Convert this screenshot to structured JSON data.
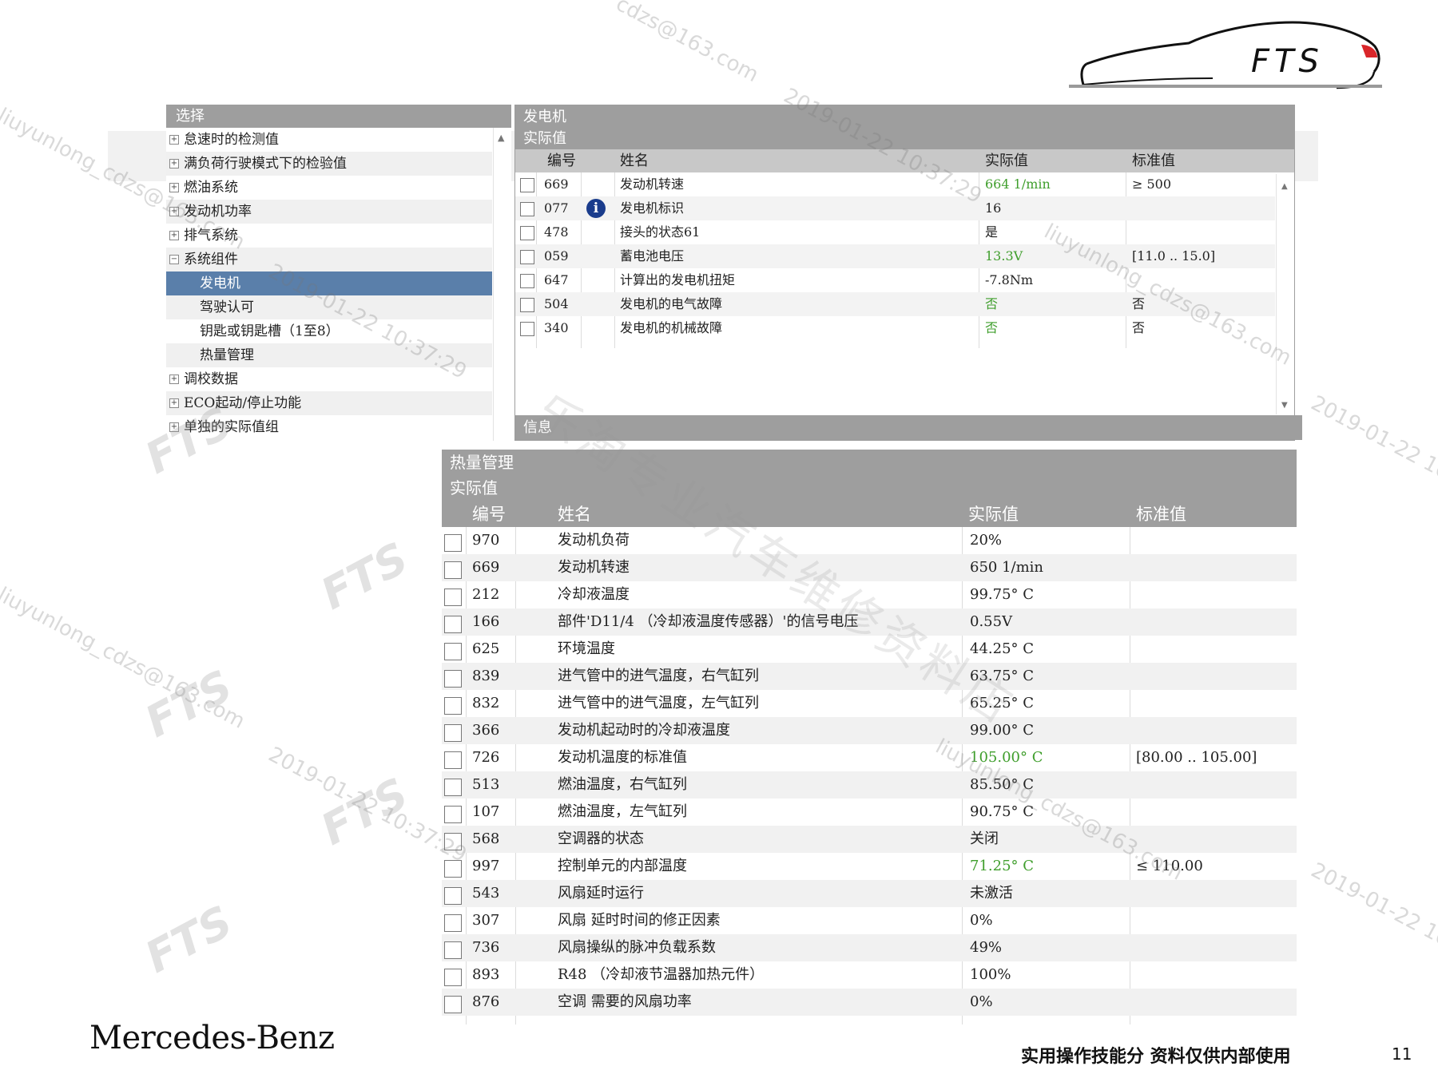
{
  "logo": {
    "text": "FTS"
  },
  "tree": {
    "title": "选择",
    "items": [
      {
        "label": "怠速时的检测值",
        "expander": "+"
      },
      {
        "label": "满负荷行驶模式下的检验值",
        "expander": "+"
      },
      {
        "label": "燃油系统",
        "expander": "+"
      },
      {
        "label": "发动机功率",
        "expander": "+"
      },
      {
        "label": "排气系统",
        "expander": "+"
      },
      {
        "label": "系统组件",
        "expander": "−"
      },
      {
        "label": "发电机",
        "expander": ""
      },
      {
        "label": "驾驶认可",
        "expander": ""
      },
      {
        "label": "钥匙或钥匙槽（1至8）",
        "expander": ""
      },
      {
        "label": "热量管理",
        "expander": ""
      },
      {
        "label": "调校数据",
        "expander": "+"
      },
      {
        "label": "ECO起动/停止功能",
        "expander": "+"
      },
      {
        "label": "单独的实际值组",
        "expander": "+"
      }
    ]
  },
  "generator": {
    "title": "发电机",
    "subtitle": "实际值",
    "columns": {
      "id": "编号",
      "name": "姓名",
      "actual": "实际值",
      "standard": "标准值"
    },
    "rows": [
      {
        "id": "669",
        "name": "发动机转速",
        "actual": "664 1/min",
        "standard": "≥ 500",
        "green": true
      },
      {
        "id": "077",
        "name": "发电机标识",
        "actual": "16",
        "standard": "",
        "info": "i"
      },
      {
        "id": "478",
        "name": "接头的状态61",
        "actual": "是",
        "standard": ""
      },
      {
        "id": "059",
        "name": "蓄电池电压",
        "actual": "13.3V",
        "standard": "[11.0 .. 15.0]",
        "green": true
      },
      {
        "id": "647",
        "name": "计算出的发电机扭矩",
        "actual": "-7.8Nm",
        "standard": ""
      },
      {
        "id": "504",
        "name": "发电机的电气故障",
        "actual": "否",
        "standard": "否",
        "green": true
      },
      {
        "id": "340",
        "name": "发电机的机械故障",
        "actual": "否",
        "standard": "否",
        "green": true
      }
    ],
    "info_bar": "信息"
  },
  "thermal": {
    "title": "热量管理",
    "subtitle": "实际值",
    "columns": {
      "id": "编号",
      "name": "姓名",
      "actual": "实际值",
      "standard": "标准值"
    },
    "rows": [
      {
        "id": "970",
        "name": "发动机负荷",
        "actual": "20%",
        "standard": ""
      },
      {
        "id": "669",
        "name": "发动机转速",
        "actual": "650 1/min",
        "standard": ""
      },
      {
        "id": "212",
        "name": "冷却液温度",
        "actual": "99.75° C",
        "standard": ""
      },
      {
        "id": "166",
        "name": "部件'D11/4 （冷却液温度传感器）'的信号电压",
        "actual": "0.55V",
        "standard": ""
      },
      {
        "id": "625",
        "name": "环境温度",
        "actual": "44.25° C",
        "standard": ""
      },
      {
        "id": "839",
        "name": "进气管中的进气温度，右气缸列",
        "actual": "63.75° C",
        "standard": ""
      },
      {
        "id": "832",
        "name": "进气管中的进气温度，左气缸列",
        "actual": "65.25° C",
        "standard": ""
      },
      {
        "id": "366",
        "name": "发动机起动时的冷却液温度",
        "actual": "99.00° C",
        "standard": ""
      },
      {
        "id": "726",
        "name": "发动机温度的标准值",
        "actual": "105.00° C",
        "standard": "[80.00 .. 105.00]",
        "green": true
      },
      {
        "id": "513",
        "name": "燃油温度，右气缸列",
        "actual": "85.50° C",
        "standard": ""
      },
      {
        "id": "107",
        "name": "燃油温度，左气缸列",
        "actual": "90.75° C",
        "standard": ""
      },
      {
        "id": "568",
        "name": "空调器的状态",
        "actual": "关闭",
        "standard": ""
      },
      {
        "id": "997",
        "name": "控制单元的内部温度",
        "actual": "71.25° C",
        "standard": "≤ 110.00",
        "green": true
      },
      {
        "id": "543",
        "name": "风扇延时运行",
        "actual": "未激活",
        "standard": ""
      },
      {
        "id": "307",
        "name": "风扇 延时时间的修正因素",
        "actual": "0%",
        "standard": ""
      },
      {
        "id": "736",
        "name": "风扇操纵的脉冲负载系数",
        "actual": "49%",
        "standard": ""
      },
      {
        "id": "893",
        "name": "R48 （冷却液节温器加热元件）",
        "actual": "100%",
        "standard": ""
      },
      {
        "id": "876",
        "name": "空调 需要的风扇功率",
        "actual": "0%",
        "standard": ""
      }
    ]
  },
  "footer": {
    "brand": "Mercedes-Benz",
    "note": "实用操作技能分 资料仅供内部使用",
    "page": "11"
  },
  "watermarks": {
    "email": "liuyunlong_cdzs@163.com",
    "email_tail": "cdzs@163.com",
    "timestamp": "2019-01-22 10:37:29",
    "store": "乐淘专业汽车维修资料店",
    "fts": "FTS"
  },
  "colors": {
    "header_grey": "#9e9e9e",
    "selection_blue": "#5a7faa",
    "ok_green": "#3f9e2c",
    "info_blue": "#1a3c8c",
    "logo_red": "#d9262a"
  }
}
